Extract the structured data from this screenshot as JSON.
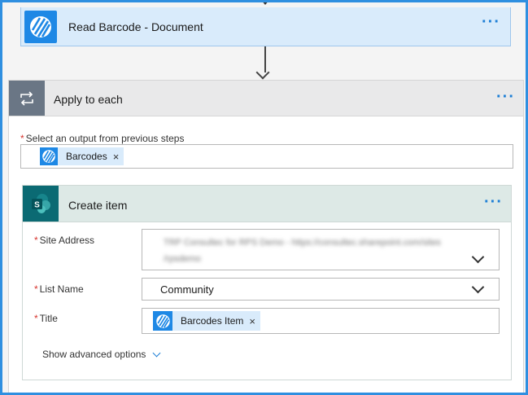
{
  "trigger": {
    "title": "Read Barcode - Document",
    "icon": "striped-logo-icon",
    "color": "#1e88e5"
  },
  "apply_to_each": {
    "title": "Apply to each",
    "icon": "loop-arrows-icon",
    "select_output_label": "Select an output from previous steps",
    "required_marker": "*",
    "token": {
      "label": "Barcodes",
      "remove": "×"
    }
  },
  "create_item": {
    "title": "Create item",
    "icon": "sharepoint-icon",
    "color": "#0b6a73",
    "fields": {
      "site_address": {
        "label": "Site Address",
        "blurred_line_1": "TRP Consultec for RPS Demo - https://consultec.sharepoint.com/sites",
        "blurred_line_2": "/rpsdemo"
      },
      "list_name": {
        "label": "List Name",
        "value": "Community"
      },
      "title": {
        "label": "Title",
        "token_label": "Barcodes Item",
        "remove": "×"
      }
    },
    "advanced_options": "Show advanced options"
  },
  "menu_icon": "ellipsis-icon",
  "accent_color": "#1e7fd6"
}
